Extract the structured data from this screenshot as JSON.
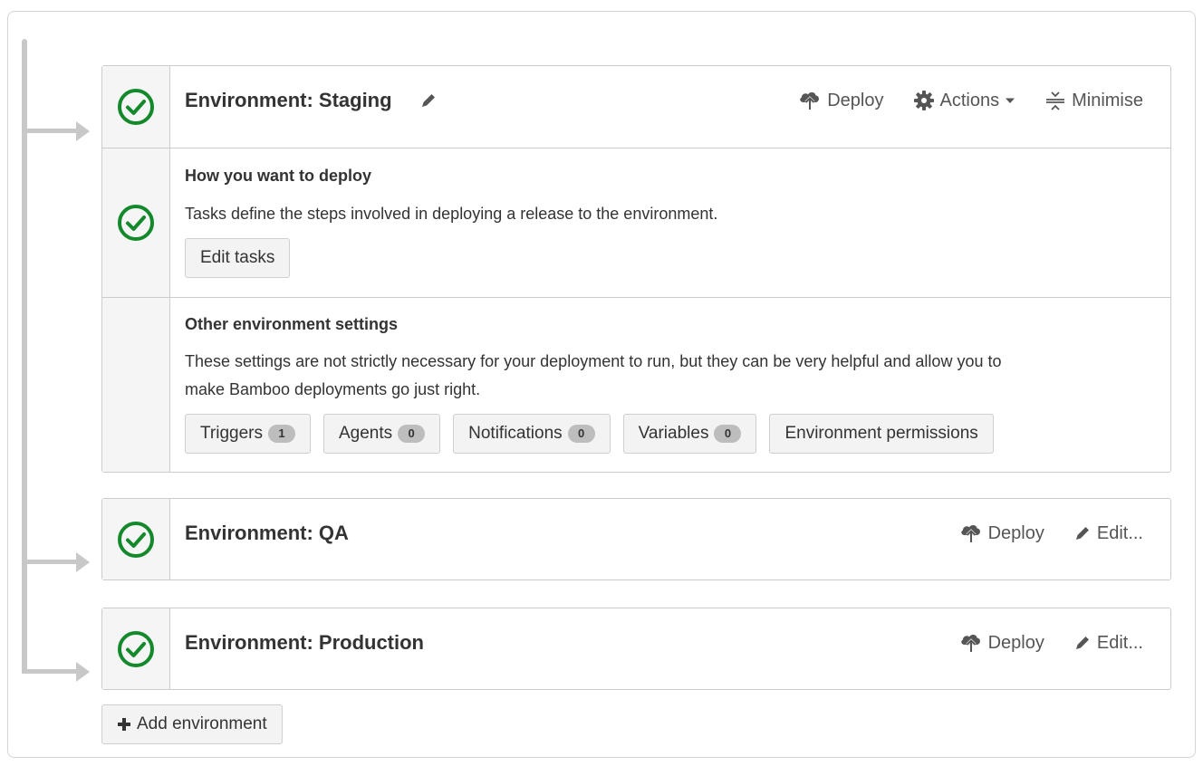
{
  "staging": {
    "title": "Environment: Staging",
    "deploy_label": "Deploy",
    "actions_label": "Actions",
    "minimise_label": "Minimise",
    "deploy_section": {
      "heading": "How you want to deploy",
      "description": "Tasks define the steps involved in deploying a release to the environment.",
      "edit_tasks_label": "Edit tasks"
    },
    "settings_section": {
      "heading": "Other environment settings",
      "description_line1": "These settings are not strictly necessary for your deployment to run, but they can be very helpful and allow you to",
      "description_line2": "make Bamboo deployments go just right.",
      "buttons": [
        {
          "label": "Triggers",
          "count": "1"
        },
        {
          "label": "Agents",
          "count": "0"
        },
        {
          "label": "Notifications",
          "count": "0"
        },
        {
          "label": "Variables",
          "count": "0"
        }
      ],
      "permissions_label": "Environment permissions"
    }
  },
  "qa": {
    "title": "Environment: QA",
    "deploy_label": "Deploy",
    "edit_label": "Edit..."
  },
  "production": {
    "title": "Environment: Production",
    "deploy_label": "Deploy",
    "edit_label": "Edit..."
  },
  "add_environment_label": "Add environment",
  "colors": {
    "success_green": "#14892c",
    "connector_gray": "#c8c8c8",
    "gutter_bg": "#f5f5f5",
    "button_bg": "#f3f3f3"
  },
  "icons": [
    "check-circle-icon",
    "pencil-icon",
    "deploy-cloud-icon",
    "gear-icon",
    "caret-down-icon",
    "minimise-icon",
    "plus-icon"
  ]
}
